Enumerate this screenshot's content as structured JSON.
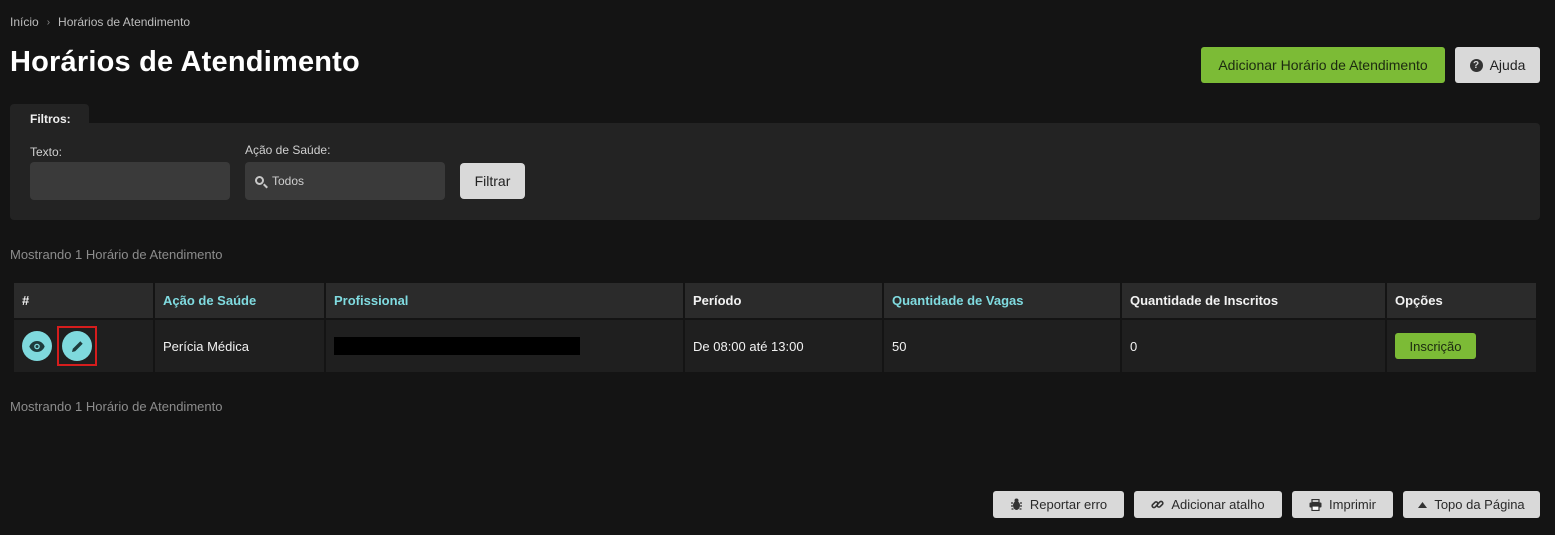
{
  "breadcrumb": {
    "home": "Início",
    "current": "Horários de Atendimento"
  },
  "page": {
    "title": "Horários de Atendimento"
  },
  "header_buttons": {
    "add": "Adicionar Horário de Atendimento",
    "help": "Ajuda"
  },
  "filters": {
    "tab_label": "Filtros:",
    "text_label": "Texto:",
    "text_value": "",
    "action_label": "Ação de Saúde:",
    "action_value": "Todos",
    "filter_button": "Filtrar"
  },
  "results": {
    "count_text": "Mostrando 1 Horário de Atendimento"
  },
  "table": {
    "headers": [
      "#",
      "Ação de Saúde",
      "Profissional",
      "Período",
      "Quantidade de Vagas",
      "Quantidade de Inscritos",
      "Opções"
    ],
    "sortable_columns": [
      "Ação de Saúde",
      "Profissional",
      "Quantidade de Vagas"
    ],
    "rows": [
      {
        "acao": "Perícia Médica",
        "profissional": "",
        "periodo": "De 08:00 até 13:00",
        "vagas": "50",
        "inscritos": "0",
        "option_button": "Inscrição"
      }
    ]
  },
  "footer": {
    "report": "Reportar erro",
    "shortcut": "Adicionar atalho",
    "print": "Imprimir",
    "top": "Topo da Página"
  },
  "colors": {
    "accent_green": "#7cbb36",
    "link_cyan": "#80dbe0",
    "icon_circle": "#7fd9dd",
    "highlight_red": "#d61d1d",
    "background": "#141414"
  }
}
